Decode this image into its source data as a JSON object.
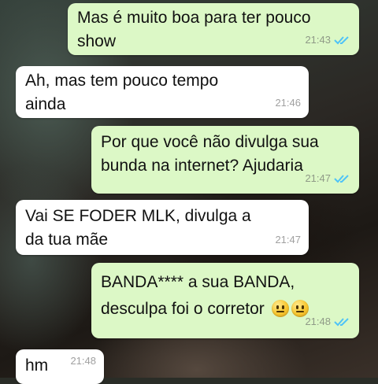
{
  "chat": {
    "messages": [
      {
        "direction": "out",
        "text": "Mas é muito boa para ter pouco\nshow",
        "time": "21:43",
        "status": "read"
      },
      {
        "direction": "in",
        "text": "Ah, mas tem pouco tempo\nainda",
        "time": "21:46"
      },
      {
        "direction": "out",
        "text": "Por que você não divulga sua\nbunda na internet? Ajudaria",
        "time": "21:47",
        "status": "read"
      },
      {
        "direction": "in",
        "text": "Vai SE FODER MLK, divulga a\nda tua mãe",
        "time": "21:47"
      },
      {
        "direction": "out",
        "text_line1": "BANDA**** a sua BANDA,",
        "text_line2": "desculpa foi o corretor",
        "emojis": [
          "neutral-face-emoji",
          "neutral-face-emoji"
        ],
        "time": "21:48",
        "status": "read"
      },
      {
        "direction": "in",
        "text": "hm",
        "time": "21:48"
      }
    ]
  },
  "colors": {
    "outgoing_bubble": "#dcf8c6",
    "incoming_bubble": "#ffffff",
    "read_ticks": "#4fc3f7"
  }
}
